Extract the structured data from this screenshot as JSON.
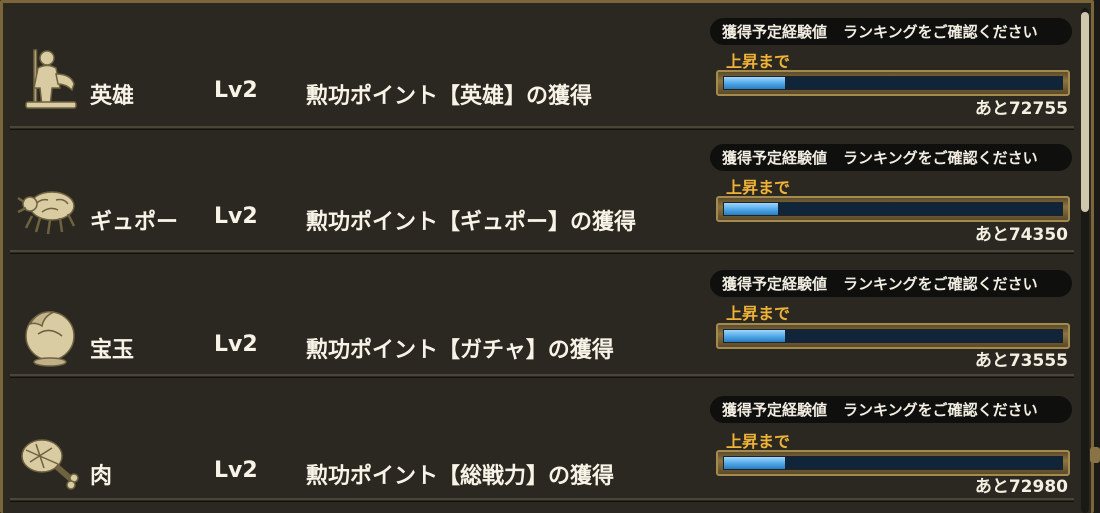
{
  "rows": [
    {
      "icon": "hero-icon",
      "name": "英雄",
      "level": "Lv2",
      "desc": "勲功ポイント【英雄】の獲得",
      "exp_label": "獲得予定経験値",
      "exp_value": "ランキングをご確認ください",
      "rise_label": "上昇まで",
      "remaining": "あと72755",
      "progress": 0.18
    },
    {
      "icon": "gyupo-bug-icon",
      "name": "ギュポー",
      "level": "Lv2",
      "desc": "勲功ポイント【ギュポー】の獲得",
      "exp_label": "獲得予定経験値",
      "exp_value": "ランキングをご確認ください",
      "rise_label": "上昇まで",
      "remaining": "あと74350",
      "progress": 0.16
    },
    {
      "icon": "gem-orb-icon",
      "name": "宝玉",
      "level": "Lv2",
      "desc": "勲功ポイント【ガチャ】の獲得",
      "exp_label": "獲得予定経験値",
      "exp_value": "ランキングをご確認ください",
      "rise_label": "上昇まで",
      "remaining": "あと73555",
      "progress": 0.18
    },
    {
      "icon": "meat-icon",
      "name": "肉",
      "level": "Lv2",
      "desc": "勲功ポイント【総戦力】の獲得",
      "exp_label": "獲得予定経験値",
      "exp_value": "ランキングをご確認ください",
      "rise_label": "上昇まで",
      "remaining": "あと72980",
      "progress": 0.18
    }
  ],
  "colors": {
    "accent": "#f0b338",
    "bar_fill": "#4ea6e6",
    "frame": "#7a6638"
  }
}
